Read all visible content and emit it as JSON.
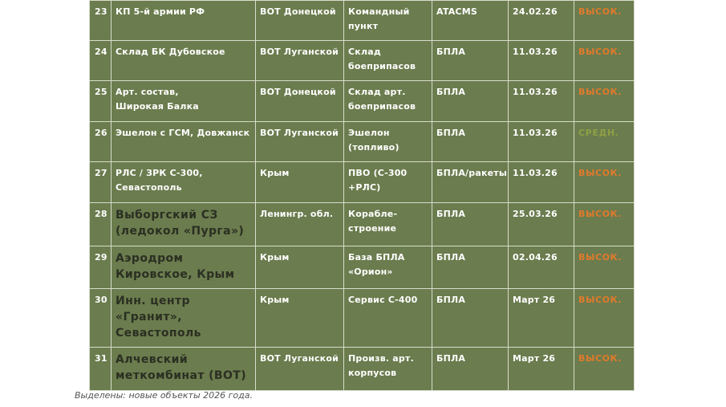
{
  "table": {
    "rows": [
      {
        "num": "23",
        "object": "КП 5-й армии РФ",
        "region": "ВОТ Донецкой",
        "type": "Командный пункт",
        "means": "ATACMS",
        "date": "24.02.26",
        "priority": "ВЫСОК.",
        "level": "high",
        "highlight": false
      },
      {
        "num": "24",
        "object": "Склад БК Дубовское",
        "region": "ВОТ Луганской",
        "type": "Склад боеприпасов",
        "means": "БПЛА",
        "date": "11.03.26",
        "priority": "ВЫСОК.",
        "level": "high",
        "highlight": false
      },
      {
        "num": "25",
        "object": "Арт. состав, Широкая Балка",
        "region": "ВОТ Донецкой",
        "type": "Склад арт. боеприпасов",
        "means": "БПЛА",
        "date": "11.03.26",
        "priority": "ВЫСОК.",
        "level": "high",
        "highlight": false
      },
      {
        "num": "26",
        "object": "Эшелон с ГСМ, Довжанск",
        "region": "ВОТ Луганской",
        "type": "Эшелон (топливо)",
        "means": "БПЛА",
        "date": "11.03.26",
        "priority": "СРЕДН.",
        "level": "mid",
        "highlight": false
      },
      {
        "num": "27",
        "object": "РЛС / ЗРК С-300, Севастополь",
        "region": "Крым",
        "type": "ПВО (С-300 +РЛС)",
        "means": "БПЛА/ракеты",
        "date": "11.03.26",
        "priority": "ВЫСОК.",
        "level": "high",
        "highlight": false
      },
      {
        "num": "28",
        "object": "Выборгский СЗ (ледокол «Пурга»)",
        "region": "Ленингр. обл.",
        "type": "Корабле-строение",
        "means": "БПЛА",
        "date": "25.03.26",
        "priority": "ВЫСОК.",
        "level": "high",
        "highlight": true
      },
      {
        "num": "29",
        "object": "Аэродром Кировское, Крым",
        "region": "Крым",
        "type": "База БПЛА «Орион»",
        "means": "БПЛА",
        "date": "02.04.26",
        "priority": "ВЫСОК.",
        "level": "high",
        "highlight": true
      },
      {
        "num": "30",
        "object": "Инн. центр «Гранит», Севастополь",
        "region": "Крым",
        "type": "Сервис С-400",
        "means": "БПЛА",
        "date": "Март 26",
        "priority": "ВЫСОК.",
        "level": "high",
        "highlight": true
      },
      {
        "num": "31",
        "object": "Алчевский меткомбинат (ВОТ)",
        "region": "ВОТ Луганской",
        "type": "Произв. арт. корпусов",
        "means": "БПЛА",
        "date": "Март 26",
        "priority": "ВЫСОК.",
        "level": "high",
        "highlight": true
      }
    ]
  },
  "caption": "Выделены: новые объекты 2026 года.",
  "colors": {
    "cell_bg": "#6b7c4e",
    "high": "#e07a2c",
    "mid": "#8fa046",
    "highlight_text": "#2b2f22"
  }
}
